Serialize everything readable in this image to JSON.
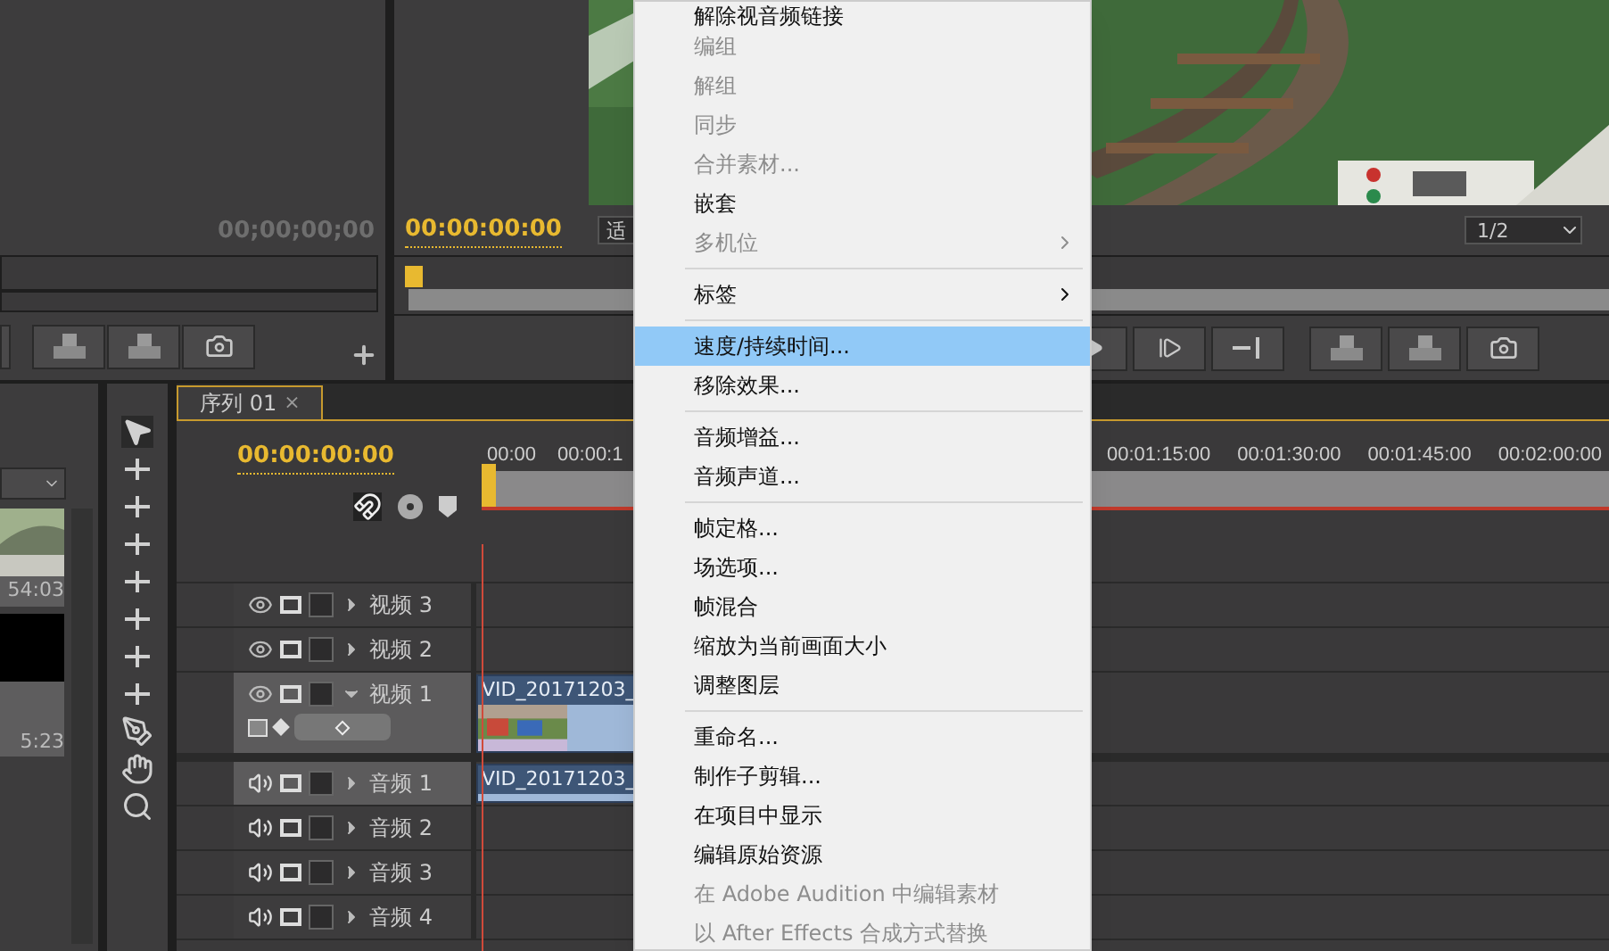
{
  "source_monitor": {
    "timecode": "00;00;00;00"
  },
  "program_monitor": {
    "timecode": "00:00:00:00",
    "zoom": "适",
    "resolution": "1/2"
  },
  "project_panel": {
    "items": [
      {
        "duration": "54:03",
        "kind": "picture"
      },
      {
        "duration": "5:23",
        "kind": "black"
      }
    ]
  },
  "timeline": {
    "tab": "序列 01",
    "close": "×",
    "timecode": "00:00:00:00",
    "ruler_left": [
      "00:00",
      "00:00:1"
    ],
    "ruler_right": [
      "00:01:15:00",
      "00:01:30:00",
      "00:01:45:00",
      "00:02:00:00"
    ],
    "tracks": [
      {
        "kind": "video",
        "name": "视频 3",
        "expanded": false,
        "selected": false
      },
      {
        "kind": "video",
        "name": "视频 2",
        "expanded": false,
        "selected": false
      },
      {
        "kind": "video",
        "name": "视频 1",
        "expanded": true,
        "selected": true,
        "clip": "VID_20171203_"
      },
      {
        "kind": "audio",
        "name": "音频 1",
        "expanded": false,
        "selected": true,
        "clip": "VID_20171203_"
      },
      {
        "kind": "audio",
        "name": "音频 2",
        "expanded": false,
        "selected": false
      },
      {
        "kind": "audio",
        "name": "音频 3",
        "expanded": false,
        "selected": false
      },
      {
        "kind": "audio",
        "name": "音频 4",
        "expanded": false,
        "selected": false
      }
    ]
  },
  "context_menu": {
    "groups": [
      [
        {
          "label": "解除视音频链接",
          "disabled": false,
          "submenu": false,
          "selected": false
        },
        {
          "label": "编组",
          "disabled": true,
          "submenu": false,
          "selected": false
        },
        {
          "label": "解组",
          "disabled": true,
          "submenu": false,
          "selected": false
        },
        {
          "label": "同步",
          "disabled": true,
          "submenu": false,
          "selected": false
        },
        {
          "label": "合并素材...",
          "disabled": true,
          "submenu": false,
          "selected": false
        },
        {
          "label": "嵌套",
          "disabled": false,
          "submenu": false,
          "selected": false
        },
        {
          "label": "多机位",
          "disabled": true,
          "submenu": true,
          "selected": false
        }
      ],
      [
        {
          "label": "标签",
          "disabled": false,
          "submenu": true,
          "selected": false
        }
      ],
      [
        {
          "label": "速度/持续时间...",
          "disabled": false,
          "submenu": false,
          "selected": true
        },
        {
          "label": "移除效果...",
          "disabled": false,
          "submenu": false,
          "selected": false
        }
      ],
      [
        {
          "label": "音频增益...",
          "disabled": false,
          "submenu": false,
          "selected": false
        },
        {
          "label": "音频声道...",
          "disabled": false,
          "submenu": false,
          "selected": false
        }
      ],
      [
        {
          "label": "帧定格...",
          "disabled": false,
          "submenu": false,
          "selected": false
        },
        {
          "label": "场选项...",
          "disabled": false,
          "submenu": false,
          "selected": false
        },
        {
          "label": "帧混合",
          "disabled": false,
          "submenu": false,
          "selected": false
        },
        {
          "label": "缩放为当前画面大小",
          "disabled": false,
          "submenu": false,
          "selected": false
        },
        {
          "label": "调整图层",
          "disabled": false,
          "submenu": false,
          "selected": false
        }
      ],
      [
        {
          "label": "重命名...",
          "disabled": false,
          "submenu": false,
          "selected": false
        },
        {
          "label": "制作子剪辑...",
          "disabled": false,
          "submenu": false,
          "selected": false
        },
        {
          "label": "在项目中显示",
          "disabled": false,
          "submenu": false,
          "selected": false
        },
        {
          "label": "编辑原始资源",
          "disabled": false,
          "submenu": false,
          "selected": false
        },
        {
          "label": "在 Adobe Audition 中编辑素材",
          "disabled": true,
          "submenu": false,
          "selected": false
        },
        {
          "label": "以 After Effects 合成方式替换",
          "disabled": true,
          "submenu": false,
          "selected": false
        }
      ]
    ]
  }
}
